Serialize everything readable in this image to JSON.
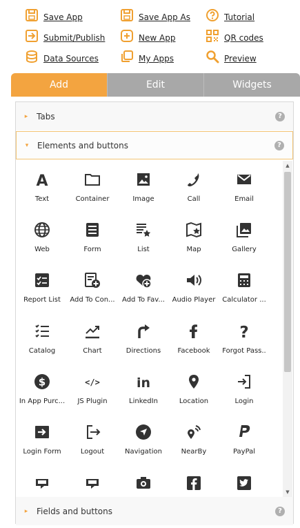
{
  "toplinks": [
    {
      "label": "Save App",
      "icon": "save-icon"
    },
    {
      "label": "Save App As",
      "icon": "save-icon"
    },
    {
      "label": "Tutorial",
      "icon": "help-circle-icon"
    },
    {
      "label": "Submit/Publish",
      "icon": "submit-icon"
    },
    {
      "label": "New App",
      "icon": "plus-icon"
    },
    {
      "label": "QR codes",
      "icon": "qr-code-icon"
    },
    {
      "label": "Data Sources",
      "icon": "database-icon"
    },
    {
      "label": "My Apps",
      "icon": "copy-icon"
    },
    {
      "label": "Preview",
      "icon": "search-icon"
    }
  ],
  "tabs": [
    {
      "label": "Add",
      "active": true
    },
    {
      "label": "Edit",
      "active": false
    },
    {
      "label": "Widgets",
      "active": false
    }
  ],
  "sections": {
    "tabs": {
      "label": "Tabs",
      "arrow": "▸"
    },
    "elements": {
      "label": "Elements and buttons",
      "arrow": "▾"
    },
    "fields": {
      "label": "Fields and buttons",
      "arrow": "▸"
    },
    "help": "?"
  },
  "elements": [
    {
      "label": "Text",
      "icon": "text-icon"
    },
    {
      "label": "Container",
      "icon": "folder-icon"
    },
    {
      "label": "Image",
      "icon": "image-icon"
    },
    {
      "label": "Call",
      "icon": "phone-icon"
    },
    {
      "label": "Email",
      "icon": "email-icon"
    },
    {
      "label": "Web",
      "icon": "globe-icon"
    },
    {
      "label": "Form",
      "icon": "form-icon"
    },
    {
      "label": "List",
      "icon": "list-star-icon"
    },
    {
      "label": "Map",
      "icon": "map-icon"
    },
    {
      "label": "Gallery",
      "icon": "gallery-icon"
    },
    {
      "label": "Report List",
      "icon": "report-list-icon"
    },
    {
      "label": "Add To Con...",
      "icon": "add-contact-icon"
    },
    {
      "label": "Add To Fav...",
      "icon": "add-favorite-icon"
    },
    {
      "label": "Audio Player",
      "icon": "speaker-icon"
    },
    {
      "label": "Calculator ...",
      "icon": "calculator-icon"
    },
    {
      "label": "Catalog",
      "icon": "catalog-icon"
    },
    {
      "label": "Chart",
      "icon": "chart-icon"
    },
    {
      "label": "Directions",
      "icon": "directions-icon"
    },
    {
      "label": "Facebook",
      "icon": "facebook-icon"
    },
    {
      "label": "Forgot Pass..",
      "icon": "question-icon"
    },
    {
      "label": "In App Purc...",
      "icon": "dollar-icon"
    },
    {
      "label": "JS Plugin",
      "icon": "code-icon"
    },
    {
      "label": "LinkedIn",
      "icon": "linkedin-icon"
    },
    {
      "label": "Location",
      "icon": "location-pin-icon"
    },
    {
      "label": "Login",
      "icon": "login-icon"
    },
    {
      "label": "Login Form",
      "icon": "login-form-icon"
    },
    {
      "label": "Logout",
      "icon": "logout-icon"
    },
    {
      "label": "Navigation",
      "icon": "navigation-icon"
    },
    {
      "label": "NearBy",
      "icon": "nearby-icon"
    },
    {
      "label": "PayPal",
      "icon": "paypal-icon"
    },
    {
      "label": "",
      "icon": "message-icon"
    },
    {
      "label": "",
      "icon": "message-icon"
    },
    {
      "label": "",
      "icon": "camera-icon"
    },
    {
      "label": "",
      "icon": "facebook-square-icon"
    },
    {
      "label": "",
      "icon": "twitter-icon"
    }
  ],
  "colors": {
    "accent": "#f3a440",
    "tab_inactive": "#a8a8a8",
    "link_icon": "#f0a030"
  }
}
